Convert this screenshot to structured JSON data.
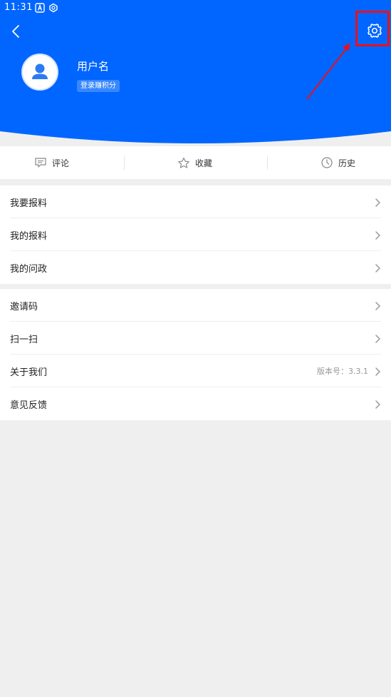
{
  "status_bar": {
    "time": "11:31",
    "icons": [
      "notification-a-icon",
      "sync-icon"
    ]
  },
  "header": {
    "back_icon": "chevron-left-icon",
    "settings_icon": "gear-icon",
    "username": "用户名",
    "points_label": "登录赚积分",
    "avatar_icon": "person-icon"
  },
  "quick_actions": [
    {
      "label": "评论",
      "icon": "comment-icon"
    },
    {
      "label": "收藏",
      "icon": "star-icon"
    },
    {
      "label": "历史",
      "icon": "clock-icon"
    }
  ],
  "group1": [
    {
      "label": "我要报料"
    },
    {
      "label": "我的报料"
    },
    {
      "label": "我的问政"
    }
  ],
  "group2": [
    {
      "label": "邀请码",
      "value": ""
    },
    {
      "label": "扫一扫",
      "value": ""
    },
    {
      "label": "关于我们",
      "value": "版本号：3.3.1"
    },
    {
      "label": "意见反馈",
      "value": ""
    }
  ],
  "colors": {
    "brand_blue": "#0066ff",
    "page_background": "#efefef",
    "annotation_red": "#e8101e"
  }
}
